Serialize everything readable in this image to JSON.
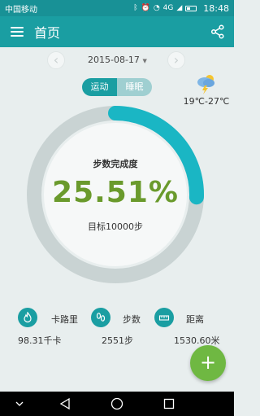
{
  "status_bar": {
    "carrier": "中国移动",
    "network": "4G",
    "time": "18:48"
  },
  "app_bar": {
    "title": "首页",
    "menu_icon": "menu-icon",
    "share_icon": "share-icon"
  },
  "date_nav": {
    "date": "2015-08-17",
    "prev_icon": "chevron-left-icon",
    "next_icon": "chevron-right-icon"
  },
  "mode_toggle": {
    "options": [
      "运动",
      "睡眠"
    ],
    "selected": "运动"
  },
  "weather": {
    "icon": "thunderstorm-icon",
    "temperature": "19℃-27℃"
  },
  "progress": {
    "label": "步数完成度",
    "percent_text": "25.51%",
    "percent_value": 25.51,
    "goal": "目标10000步",
    "accent_color": "#1ab6c4",
    "track_color": "#c9d3d3",
    "text_color": "#6a9a2c"
  },
  "stats": [
    {
      "icon": "flame-icon",
      "label": "卡路里",
      "value": "98.31千卡"
    },
    {
      "icon": "footprints-icon",
      "label": "步数",
      "value": "2551步"
    },
    {
      "icon": "ruler-icon",
      "label": "距离",
      "value": "1530.60米"
    }
  ],
  "fab": {
    "label": "+",
    "color": "#6fb842"
  },
  "colors": {
    "primary": "#1a9ea2",
    "status_bar": "#189196",
    "background": "#e8eeee"
  }
}
